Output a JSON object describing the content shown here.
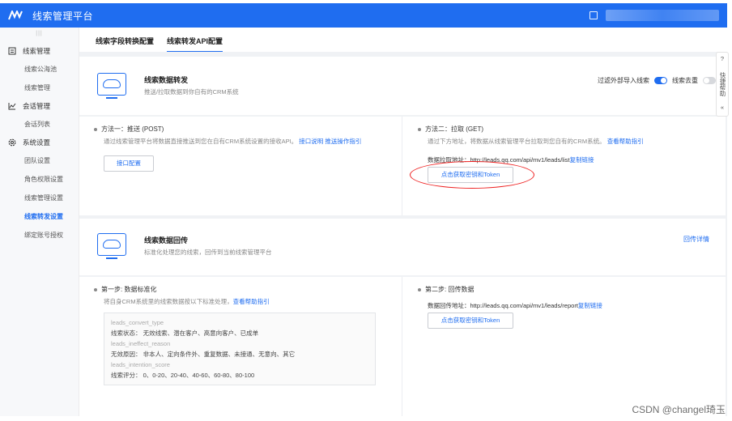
{
  "app": {
    "title": "线索管理平台"
  },
  "sidebar": {
    "groups": [
      {
        "label": "线索管理",
        "icon": "list-icon",
        "items": [
          {
            "label": "线索公海池"
          },
          {
            "label": "线索管理"
          }
        ]
      },
      {
        "label": "会话管理",
        "icon": "chart-icon",
        "items": [
          {
            "label": "会话列表"
          }
        ]
      },
      {
        "label": "系统设置",
        "icon": "gear-icon",
        "items": [
          {
            "label": "团队设置"
          },
          {
            "label": "角色权限设置"
          },
          {
            "label": "线索管理设置"
          },
          {
            "label": "线索转发设置",
            "active": true
          },
          {
            "label": "绑定账号授权"
          }
        ]
      }
    ]
  },
  "tabs": [
    {
      "label": "线索字段转换配置"
    },
    {
      "label": "线索转发API配置",
      "active": true
    }
  ],
  "forward": {
    "title": "线索数据转发",
    "desc": "推送/拉取数据到你自有的CRM系统",
    "filter_label": "过滤外部导入线索",
    "dedup_label": "线索去重",
    "filter_on": true,
    "dedup_on": false
  },
  "method1": {
    "title": "方法一：推送 (POST)",
    "desc": "通过线索管理平台将数据直接推送到您在自有CRM系统设置的接收API。",
    "link1": "接口说明",
    "link2": "推送操作指引",
    "button": "接口配置"
  },
  "method2": {
    "title": "方法二：拉取 (GET)",
    "desc": "通过下方地址，将数据从线索管理平台拉取到您自有的CRM系统。",
    "link": "查看帮助指引",
    "addr_label": "数据拉取地址：",
    "addr_url": "http://leads.qq.com/api/mv1/leads/list",
    "copy": "复制链接",
    "button": "点击获取密钥和Token"
  },
  "callback": {
    "title": "线索数据回传",
    "desc": "标准化处理您的线索，回传到当前线索管理平台",
    "detail_link": "回传详情"
  },
  "step1": {
    "title": "第一步: 数据标准化",
    "desc": "将自身CRM系统里的线索数据按以下标准处理，",
    "link": "查看帮助指引",
    "code": [
      {
        "key": "leads_convert_type",
        "value": "线索状态： 无效线索、潜在客户、高意向客户、已成单"
      },
      {
        "key": "leads_ineffect_reason",
        "value": "无效原因： 非本人、定向条件外、重复数据、未接通、无意向、其它"
      },
      {
        "key": "leads_intention_score",
        "value": "线索评分： 0、0-20、20-40、40-60、60-80、80-100"
      }
    ]
  },
  "step2": {
    "title": "第二步: 回传数据",
    "addr_label": "数据回传地址：",
    "addr_url": "http://leads.qq.com/api/mv1/leads/report",
    "copy": "复制链接",
    "button": "点击获取密钥和Token"
  },
  "help": {
    "label": "快捷帮助"
  },
  "watermark": "CSDN @changel琦玉"
}
